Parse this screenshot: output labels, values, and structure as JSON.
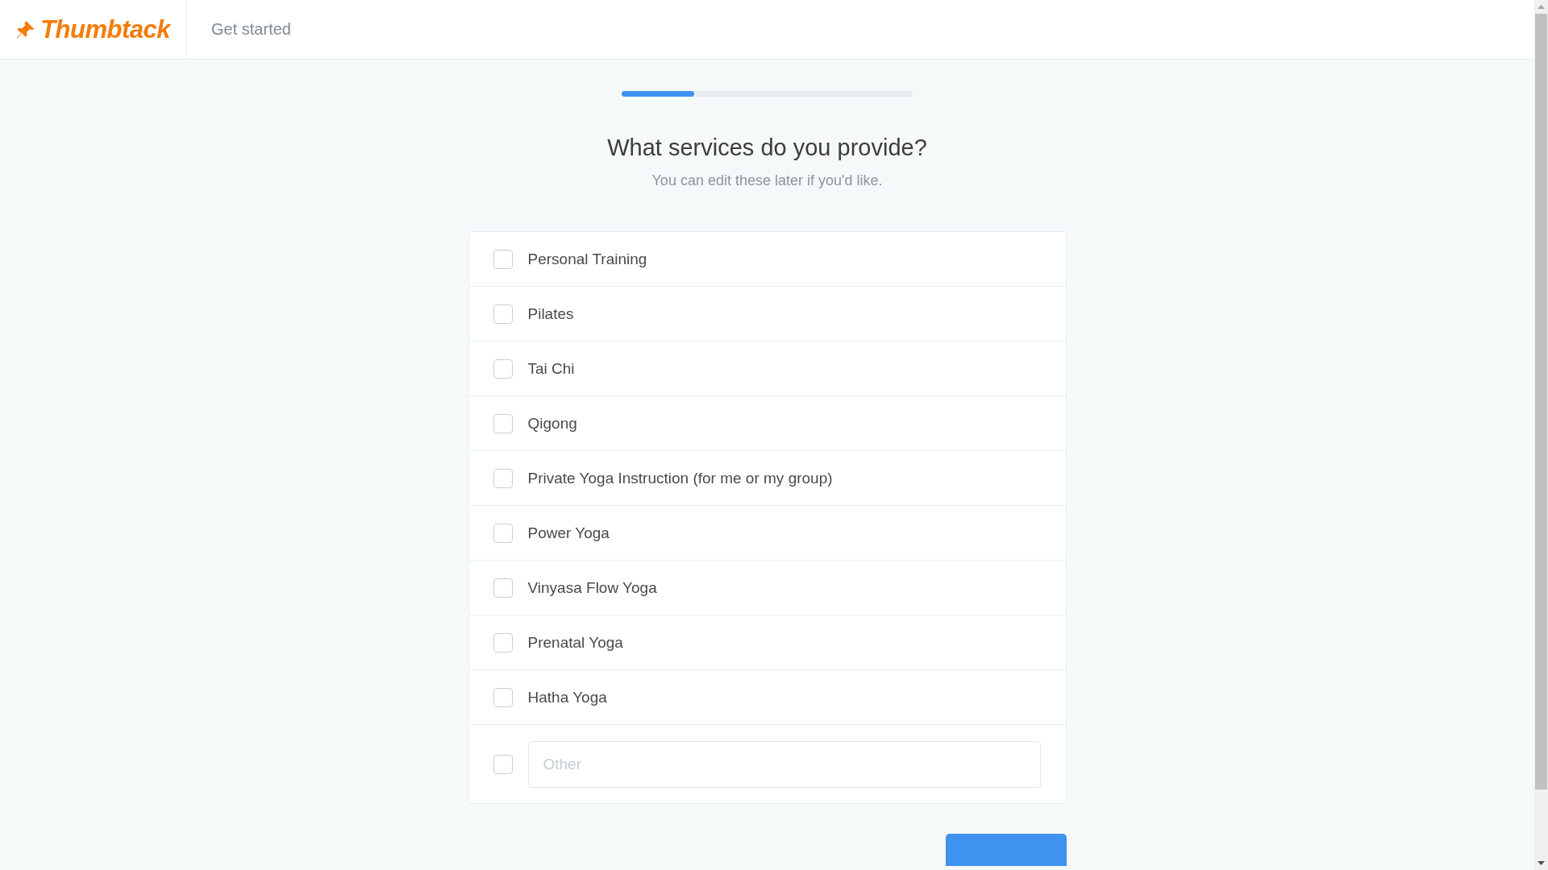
{
  "header": {
    "logo": "Thumbtack",
    "nav_link": "Get started"
  },
  "progress": {
    "level": 0.25
  },
  "heading": "What services do you provide?",
  "subheading": "You can edit these later if you'd like.",
  "services": [
    {
      "kind": "option",
      "label": "Personal Training",
      "checked": false
    },
    {
      "kind": "option",
      "label": "Pilates",
      "checked": false
    },
    {
      "kind": "option",
      "label": "Tai Chi",
      "checked": false
    },
    {
      "kind": "option",
      "label": "Qigong",
      "checked": false
    },
    {
      "kind": "option",
      "label": "Private Yoga Instruction (for me or my group)",
      "checked": false
    },
    {
      "kind": "option",
      "label": "Power Yoga",
      "checked": false
    },
    {
      "kind": "option",
      "label": "Vinyasa Flow Yoga",
      "checked": false
    },
    {
      "kind": "option",
      "label": "Prenatal Yoga",
      "checked": false
    },
    {
      "kind": "option",
      "label": "Hatha Yoga",
      "checked": false
    },
    {
      "kind": "other",
      "placeholder": "Other",
      "checked": false
    }
  ],
  "footer_button": {
    "kind": "primary"
  }
}
